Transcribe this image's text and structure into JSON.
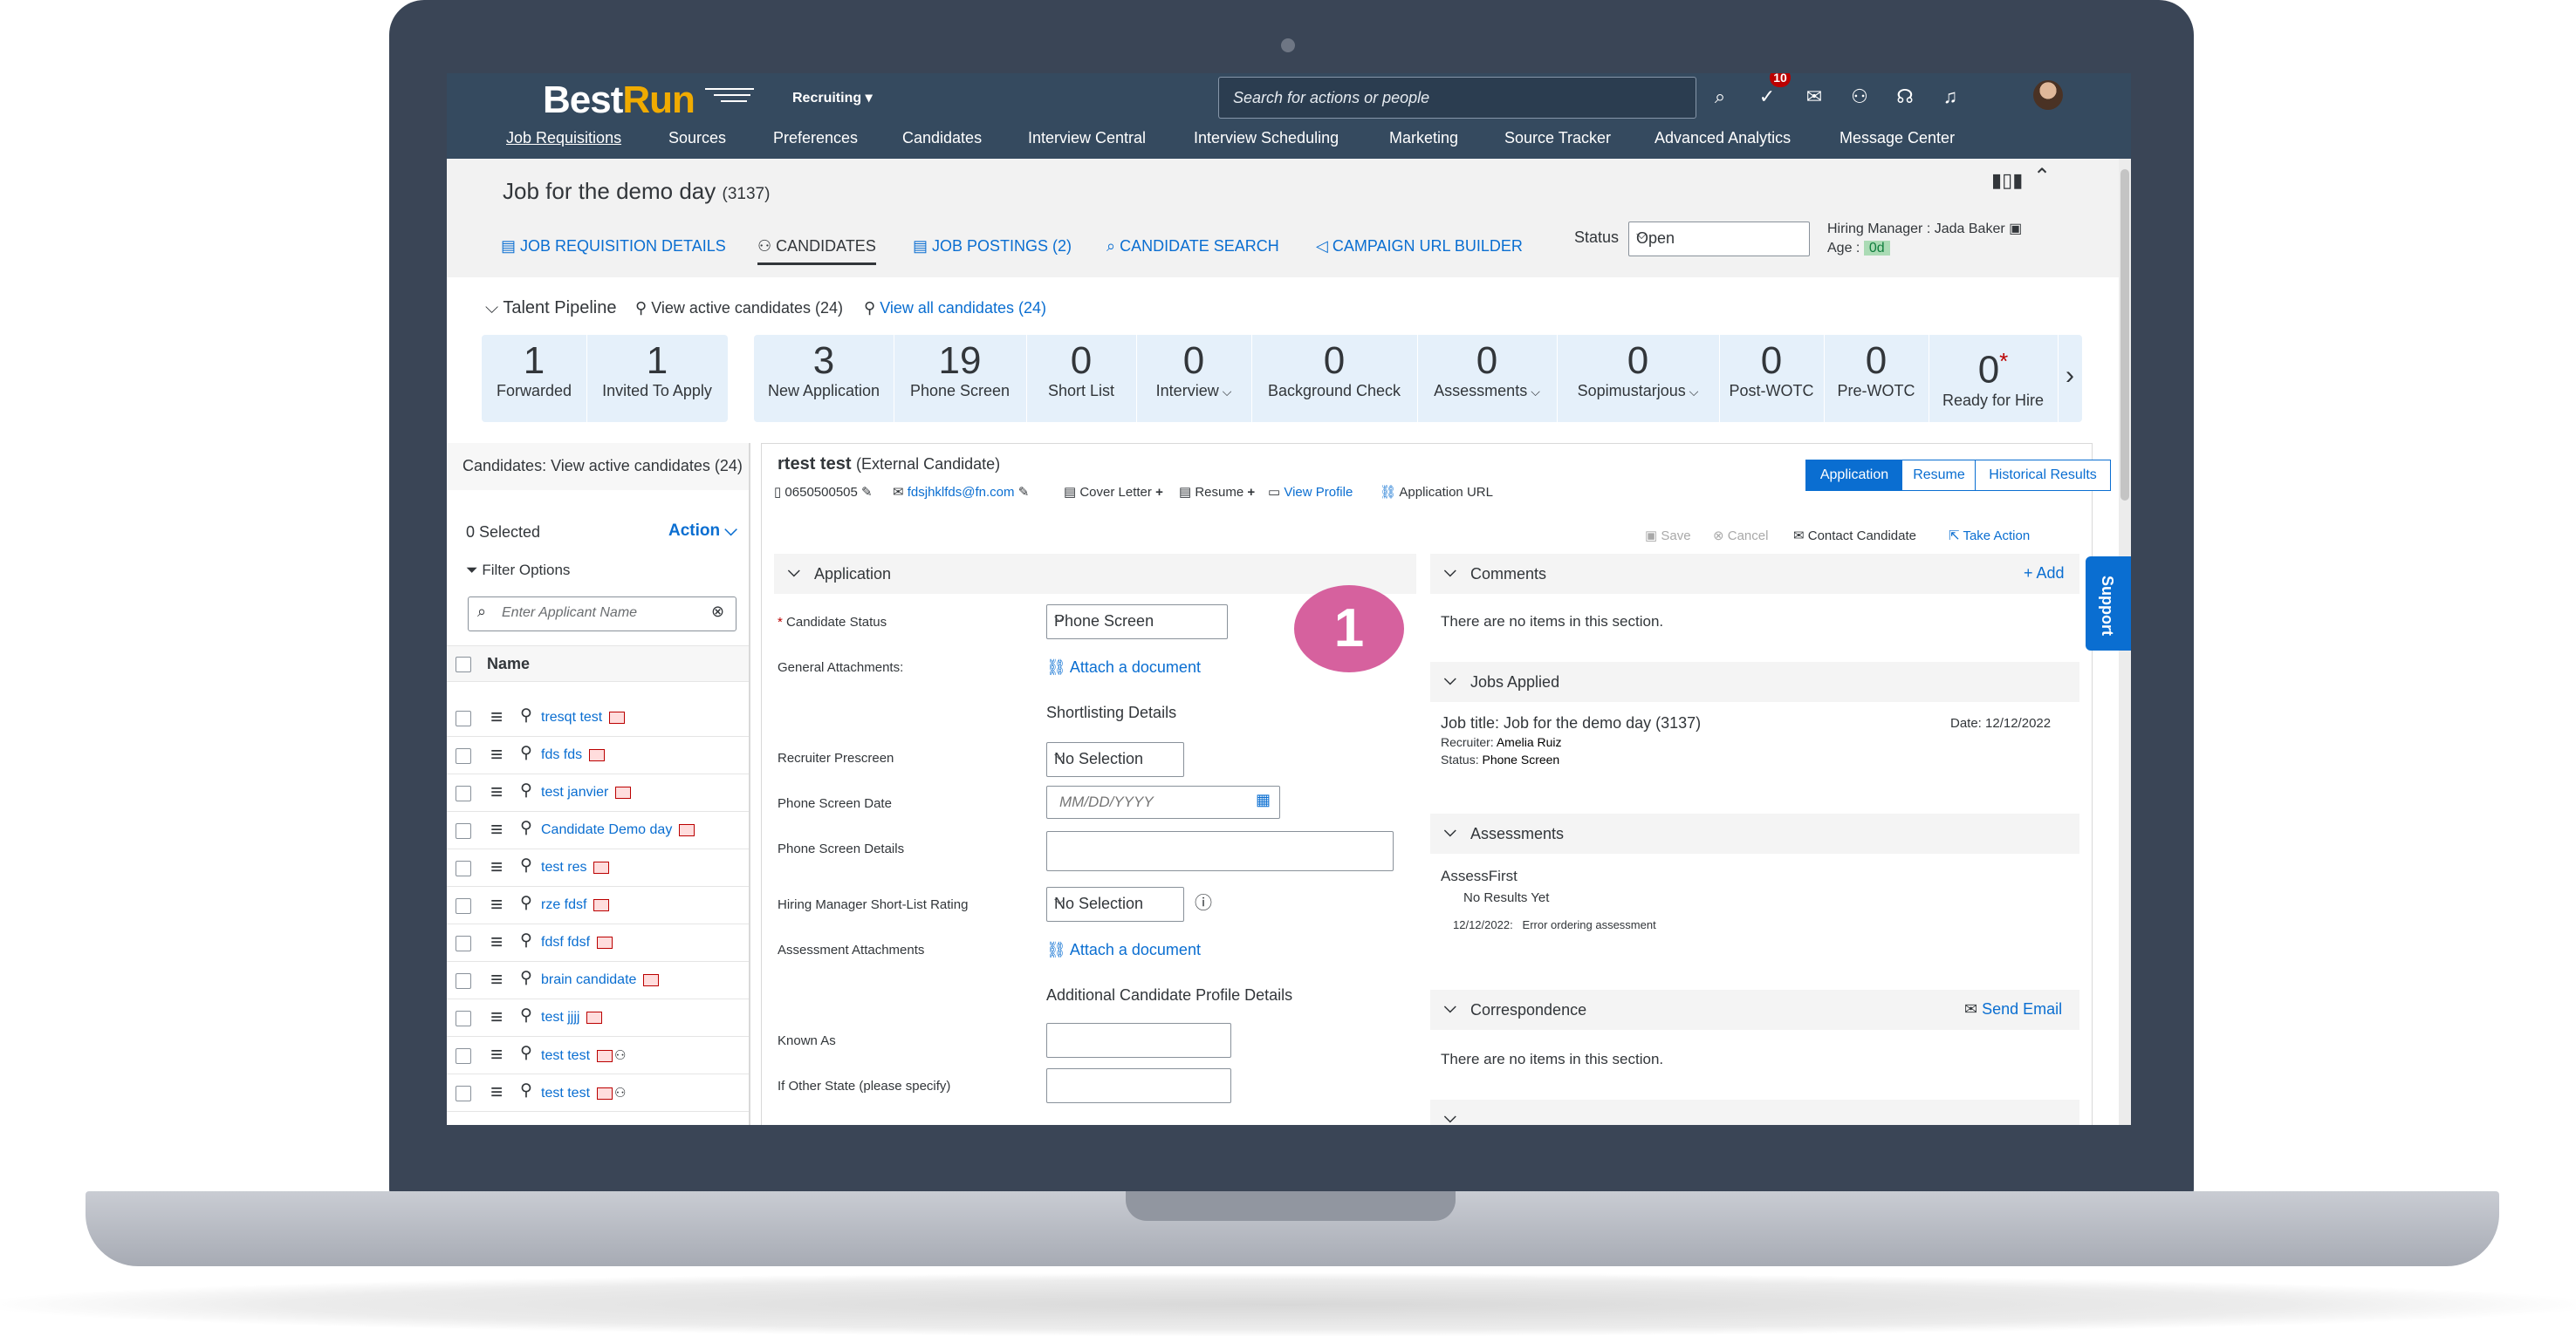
{
  "shell": {
    "logo_best": "Best",
    "logo_run": "Run",
    "module": "Recruiting",
    "search_placeholder": "Search for actions or people",
    "notification_count": "10",
    "nav": [
      "Job Requisitions",
      "Sources",
      "Preferences",
      "Candidates",
      "Interview Central",
      "Interview Scheduling",
      "Marketing",
      "Source Tracker",
      "Advanced Analytics",
      "Message Center"
    ]
  },
  "header": {
    "title": "Job for the demo day",
    "title_id": "(3137)",
    "tabs": [
      "JOB REQUISITION DETAILS",
      "CANDIDATES",
      "JOB POSTINGS (2)",
      "CANDIDATE SEARCH",
      "CAMPAIGN URL BUILDER"
    ],
    "status_label": "Status",
    "status_value": "Open",
    "hiring_manager_label": "Hiring Manager :",
    "hiring_manager": "Jada Baker",
    "age_label": "Age :",
    "age_value": "0d"
  },
  "pipeline": {
    "label": "Talent Pipeline",
    "view_active": "View active candidates (24)",
    "view_all": "View all candidates (24)",
    "tiles": [
      {
        "num": "1",
        "label": "Forwarded",
        "dd": ""
      },
      {
        "num": "1",
        "label": "Invited To Apply",
        "dd": ""
      },
      {
        "num": "3",
        "label": "New Application",
        "dd": ""
      },
      {
        "num": "19",
        "label": "Phone Screen",
        "dd": ""
      },
      {
        "num": "0",
        "label": "Short List",
        "dd": ""
      },
      {
        "num": "0",
        "label": "Interview",
        "dd": "⌵"
      },
      {
        "num": "0",
        "label": "Background Check",
        "dd": ""
      },
      {
        "num": "0",
        "label": "Assessments",
        "dd": "⌵"
      },
      {
        "num": "0",
        "label": "Sopimustarjous",
        "dd": "⌵"
      },
      {
        "num": "0",
        "label": "Post-WOTC",
        "dd": ""
      },
      {
        "num": "0",
        "label": "Pre-WOTC",
        "dd": ""
      },
      {
        "num": "0",
        "label": "Ready for Hire",
        "dd": ""
      }
    ]
  },
  "list": {
    "header": "Candidates: View active candidates (24)",
    "selected": "0 Selected",
    "action": "Action",
    "filter": "Filter Options",
    "search_placeholder": "Enter Applicant Name",
    "name_col": "Name",
    "candidates": [
      "tresqt test",
      "fds fds",
      "test janvier",
      "Candidate Demo day",
      "test res",
      "rze fdsf",
      "fdsf fdsf",
      "brain candidate",
      "test jjjj",
      "test test",
      "test test"
    ]
  },
  "candidate": {
    "name": "rtest test",
    "type": "(External Candidate)",
    "phone": "0650500505",
    "email": "fdsjhklfds@fn.com",
    "cover_letter": "Cover Letter",
    "resume": "Resume",
    "view_profile": "View Profile",
    "application_url": "Application URL",
    "segments": [
      "Application",
      "Resume",
      "Historical Results"
    ],
    "save": "Save",
    "cancel": "Cancel",
    "contact": "Contact Candidate",
    "take_action": "Take Action"
  },
  "application": {
    "section": "Application",
    "step": "1",
    "fields": {
      "status_label": "Candidate Status",
      "status_value": "Phone Screen",
      "general_attach_label": "General Attachments:",
      "attach_link": "Attach a document",
      "shortlisting": "Shortlisting Details",
      "prescreen_label": "Recruiter Prescreen",
      "prescreen_value": "No Selection",
      "phone_date_label": "Phone Screen Date",
      "phone_date_placeholder": "MM/DD/YYYY",
      "phone_details_label": "Phone Screen Details",
      "hm_rating_label": "Hiring Manager Short-List Rating",
      "hm_rating_value": "No Selection",
      "assess_attach_label": "Assessment Attachments",
      "additional": "Additional Candidate Profile Details",
      "known_as_label": "Known As",
      "other_state_label": "If Other State (please specify)"
    }
  },
  "side": {
    "comments": "Comments",
    "add": "+ Add",
    "no_items": "There are no items in this section.",
    "jobs_applied": "Jobs Applied",
    "job_title": "Job title: Job for the demo day (3137)",
    "job_date": "Date: 12/12/2022",
    "recruiter_label": "Recruiter:",
    "recruiter": "Amelia Ruiz",
    "status_label": "Status:",
    "status": "Phone Screen",
    "assessments": "Assessments",
    "assess_vendor": "AssessFirst",
    "no_results": "No Results Yet",
    "assess_date": "12/12/2022:",
    "assess_error": "Error ordering assessment",
    "correspondence": "Correspondence",
    "send_email": "Send Email",
    "no_items_2": "There are no items in this section.",
    "support": "Support"
  }
}
